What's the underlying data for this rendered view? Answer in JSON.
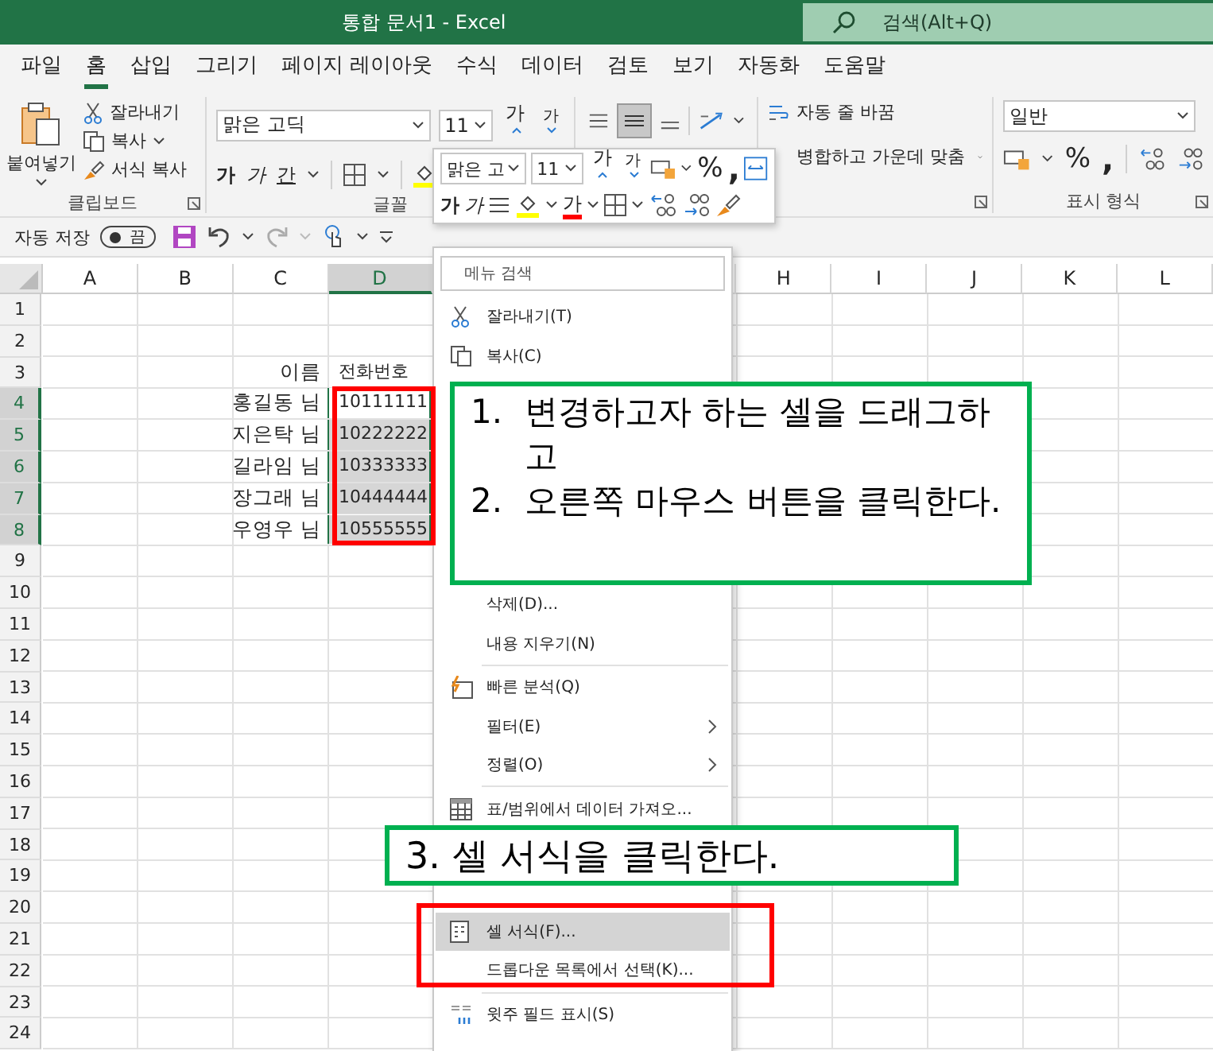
{
  "window": {
    "title": "통합 문서1  -  Excel"
  },
  "search": {
    "placeholder": "검색(Alt+Q)"
  },
  "tabs": [
    {
      "label": "파일",
      "selected": false
    },
    {
      "label": "홈",
      "selected": true
    },
    {
      "label": "삽입",
      "selected": false
    },
    {
      "label": "그리기",
      "selected": false
    },
    {
      "label": "페이지 레이아웃",
      "selected": false
    },
    {
      "label": "수식",
      "selected": false
    },
    {
      "label": "데이터",
      "selected": false
    },
    {
      "label": "검토",
      "selected": false
    },
    {
      "label": "보기",
      "selected": false
    },
    {
      "label": "자동화",
      "selected": false
    },
    {
      "label": "도움말",
      "selected": false
    }
  ],
  "ribbon": {
    "clipboard": {
      "paste": "붙여넣기",
      "cut": "잘라내기",
      "copy": "복사",
      "format_painter": "서식 복사",
      "label": "클립보드"
    },
    "font": {
      "font_name": "맑은 고딕",
      "font_size": "11",
      "grow": "가",
      "shrink": "가",
      "bold": "가",
      "italic": "가",
      "underline": "간",
      "label": "글꼴"
    },
    "alignment": {
      "wrap_text": "자동 줄 바꿈",
      "merge": "병합하고 가운데 맞춤"
    },
    "number": {
      "format": "일반",
      "percent": "%",
      "comma": ",",
      "label": "표시 형식"
    }
  },
  "quick_access": {
    "autosave_label": "자동 저장",
    "autosave": {
      "on": false,
      "text": "끔"
    }
  },
  "mini_toolbar": {
    "font_name": "맑은 고",
    "font_size": "11",
    "grow": "가",
    "shrink": "가",
    "percent": "%",
    "comma": ",",
    "bold": "가",
    "italic": "가",
    "font_color": "가"
  },
  "sheet": {
    "columns": [
      {
        "label": "A",
        "selected": false
      },
      {
        "label": "B",
        "selected": false
      },
      {
        "label": "C",
        "selected": false
      },
      {
        "label": "D",
        "selected": true
      },
      {
        "label": "H",
        "selected": false
      },
      {
        "label": "I",
        "selected": false
      },
      {
        "label": "J",
        "selected": false
      },
      {
        "label": "K",
        "selected": false
      },
      {
        "label": "L",
        "selected": false
      }
    ],
    "rows": [
      {
        "label": "1",
        "selected": false
      },
      {
        "label": "2",
        "selected": false
      },
      {
        "label": "3",
        "selected": false,
        "name": "이름",
        "phone": {
          "text": "전화번호"
        }
      },
      {
        "label": "4",
        "selected": true,
        "name": "홍길동 님",
        "phone": {
          "text": "10111111",
          "selected": true,
          "active": true
        }
      },
      {
        "label": "5",
        "selected": true,
        "name": "지은탁 님",
        "phone": {
          "text": "10222222",
          "selected": true,
          "active": false
        }
      },
      {
        "label": "6",
        "selected": true,
        "name": "길라임 님",
        "phone": {
          "text": "10333333",
          "selected": true,
          "active": false
        }
      },
      {
        "label": "7",
        "selected": true,
        "name": "장그래 님",
        "phone": {
          "text": "10444444",
          "selected": true,
          "active": false
        }
      },
      {
        "label": "8",
        "selected": true,
        "name": "우영우 님",
        "phone": {
          "text": "10555555",
          "selected": true,
          "active": false
        }
      },
      {
        "label": "9",
        "selected": false
      },
      {
        "label": "10",
        "selected": false
      },
      {
        "label": "11",
        "selected": false
      },
      {
        "label": "12",
        "selected": false
      },
      {
        "label": "13",
        "selected": false
      },
      {
        "label": "14",
        "selected": false
      },
      {
        "label": "15",
        "selected": false
      },
      {
        "label": "16",
        "selected": false
      },
      {
        "label": "17",
        "selected": false
      },
      {
        "label": "18",
        "selected": false
      },
      {
        "label": "19",
        "selected": false
      },
      {
        "label": "20",
        "selected": false
      },
      {
        "label": "21",
        "selected": false
      },
      {
        "label": "22",
        "selected": false
      },
      {
        "label": "23",
        "selected": false
      },
      {
        "label": "24",
        "selected": false
      }
    ]
  },
  "context_menu": {
    "items": [
      {
        "kind": "search",
        "placeholder": "메뉴 검색"
      },
      {
        "kind": "cut",
        "label": "잘라내기(T)",
        "selected": false
      },
      {
        "kind": "copy",
        "label": "복사(C)",
        "selected": false
      },
      {
        "kind": "covered"
      },
      {
        "kind": "covered"
      },
      {
        "kind": "covered"
      },
      {
        "kind": "covered"
      },
      {
        "kind": "covered"
      },
      {
        "kind": "plain",
        "label": "삭제(D)...",
        "selected": false
      },
      {
        "kind": "plain",
        "label": "내용 지우기(N)",
        "selected": false
      },
      {
        "kind": "separator"
      },
      {
        "kind": "analysis",
        "label": "빠른 분석(Q)",
        "selected": false
      },
      {
        "kind": "submenu",
        "label": "필터(E)",
        "selected": false
      },
      {
        "kind": "submenu",
        "label": "정렬(O)",
        "selected": false
      },
      {
        "kind": "separator"
      },
      {
        "kind": "table",
        "label": "표/범위에서 데이터 가져오...",
        "selected": false
      },
      {
        "kind": "covered"
      },
      {
        "kind": "covered"
      },
      {
        "kind": "format",
        "label": "셀 서식(F)...",
        "selected": true
      },
      {
        "kind": "plain",
        "label": "드롭다운 목록에서 선택(K)...",
        "selected": false
      },
      {
        "kind": "separator"
      },
      {
        "kind": "phonetic",
        "label": "윗주 필드 표시(S)",
        "selected": false
      }
    ]
  },
  "callouts": [
    {
      "kind": "steps",
      "color": "#00b050",
      "steps": [
        {
          "number": "1.",
          "text": "변경하고자 하는 셀을 드래그하고"
        },
        {
          "number": "2.",
          "text": "오른쪽 마우스 버튼을 클릭한다."
        }
      ]
    },
    {
      "kind": "outline",
      "color": "#ff0000"
    },
    {
      "kind": "note",
      "color": "#00b050",
      "text": "3. 셀 서식을 클릭한다."
    },
    {
      "kind": "outline",
      "color": "#ff0000"
    }
  ]
}
